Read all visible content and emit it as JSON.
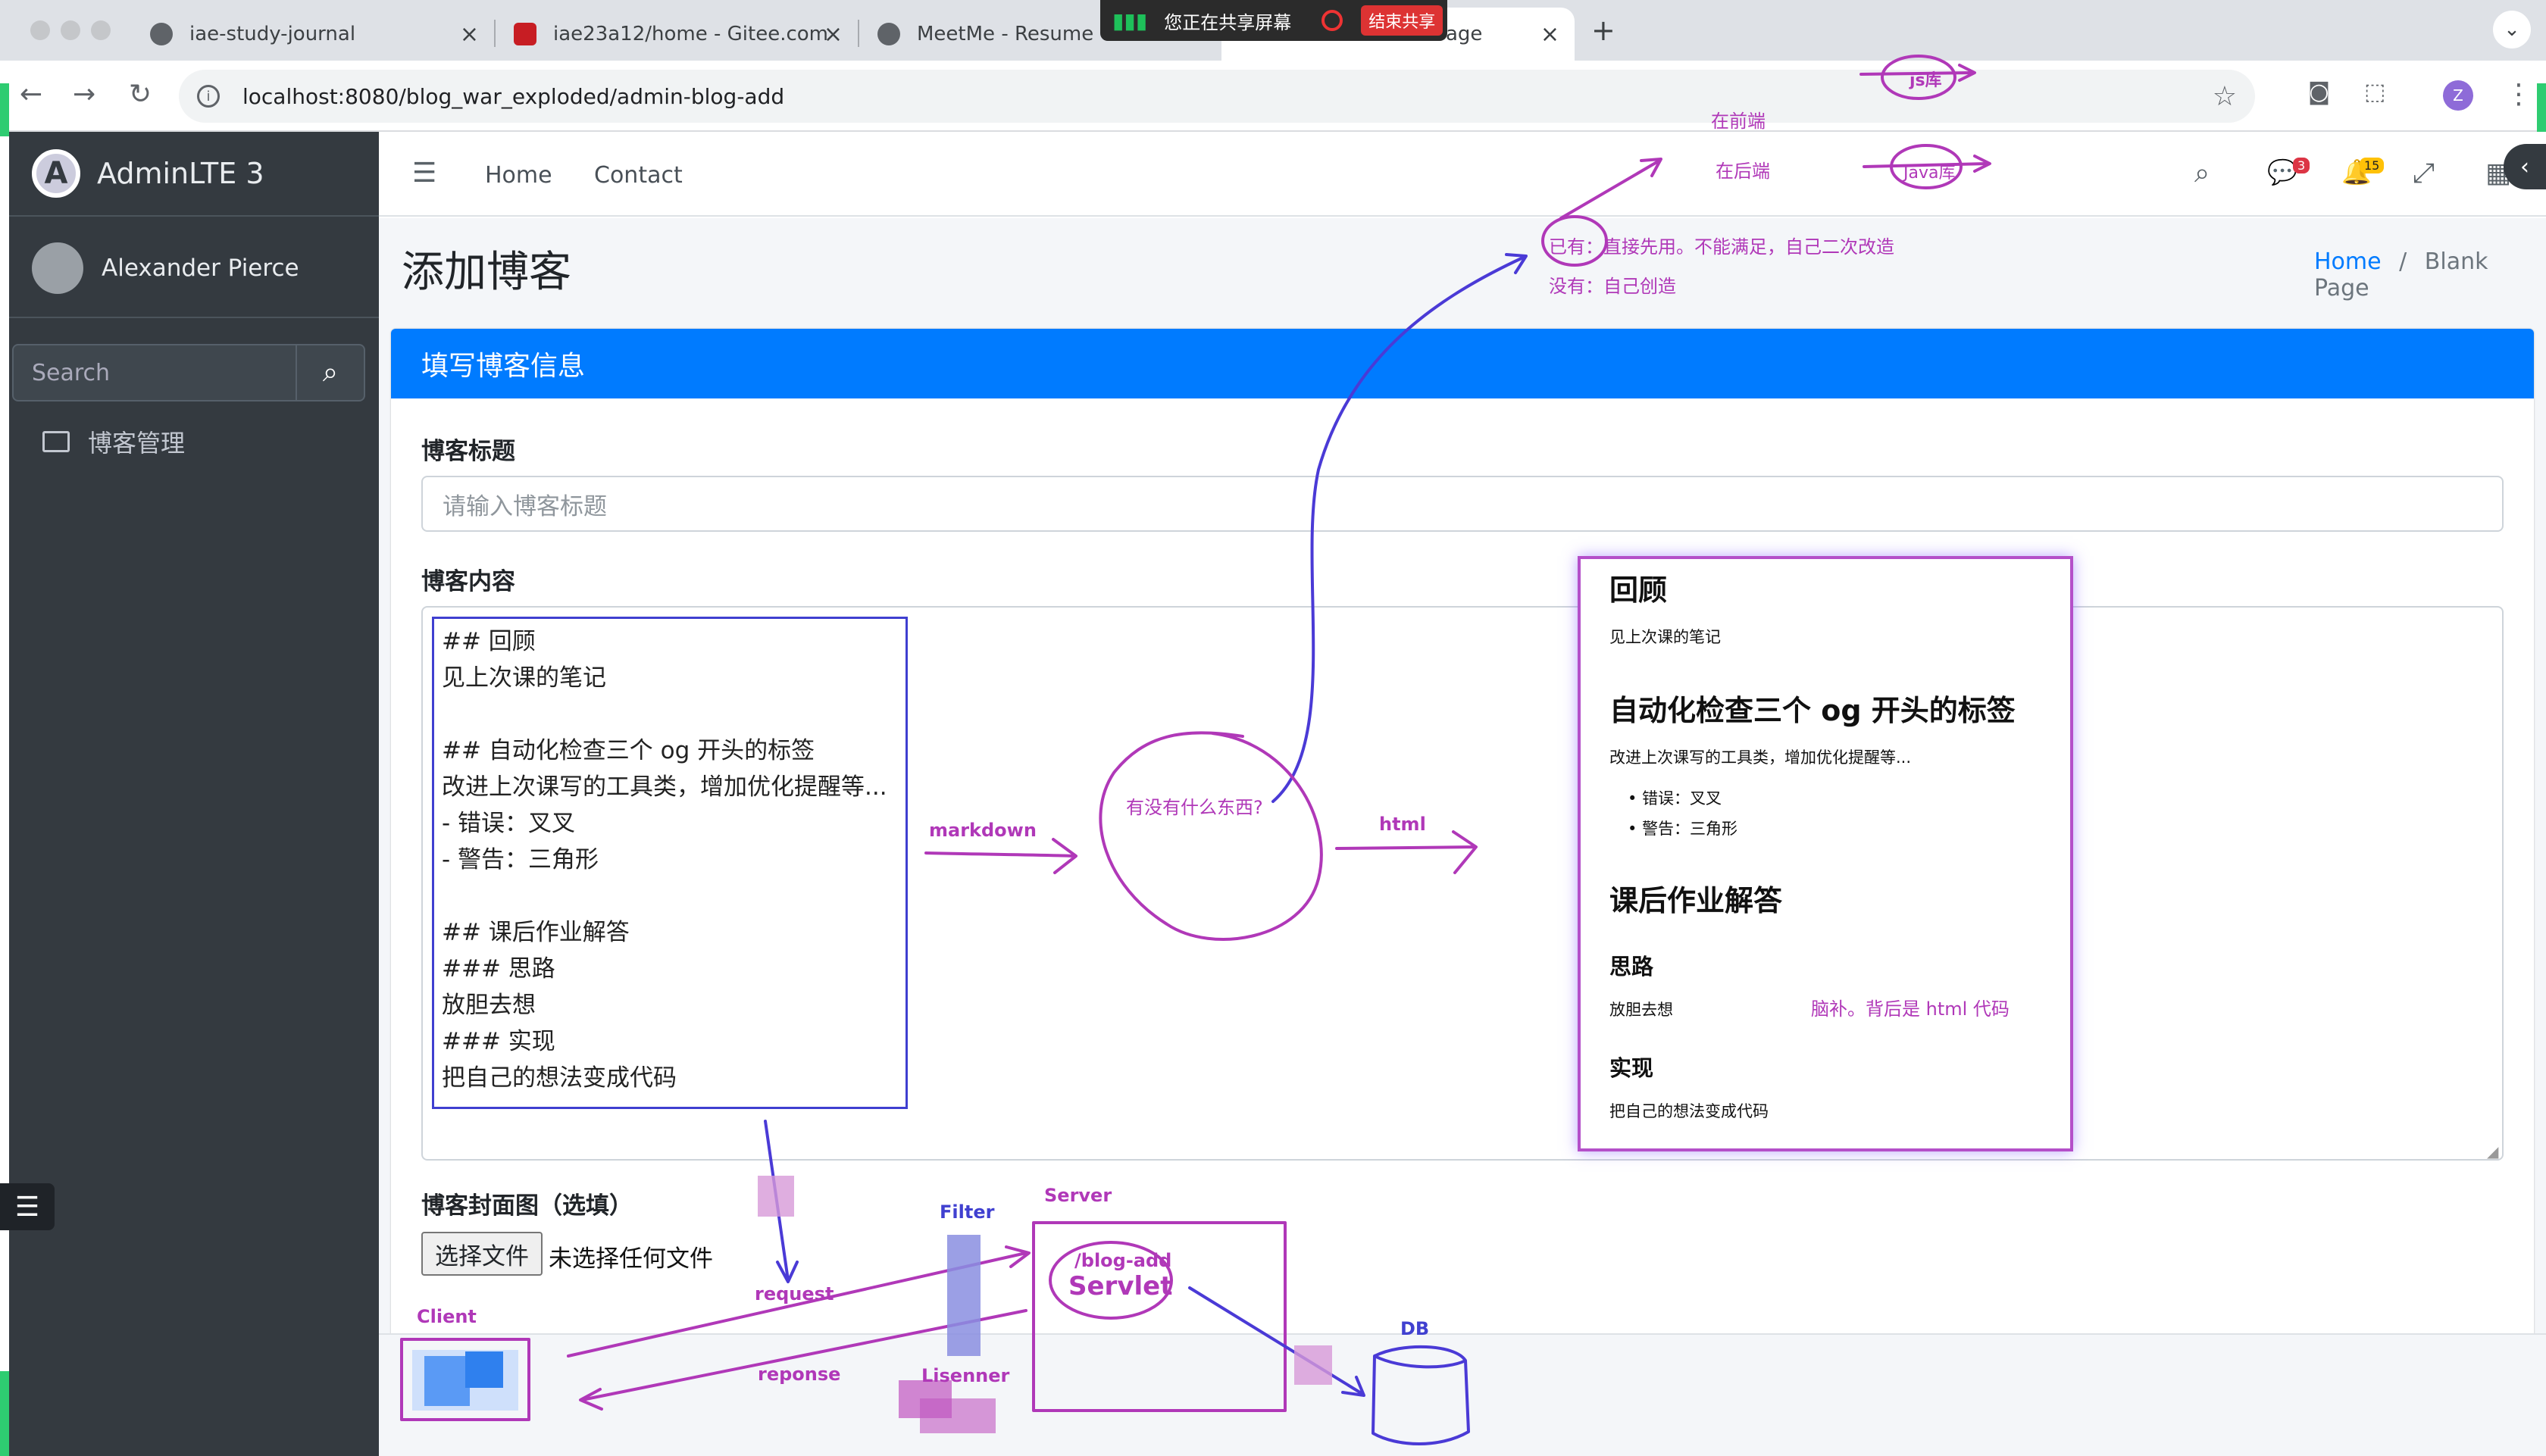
{
  "browser": {
    "tabs": [
      {
        "title": "iae-study-journal"
      },
      {
        "title": "iae23a12/home - Gitee.com"
      },
      {
        "title": "MeetMe - Resume We"
      },
      {
        "title": "age"
      }
    ],
    "new_tab_symbol": "+",
    "share_bar": {
      "text": "您正在共享屏幕",
      "stop_label": "结束共享"
    },
    "url": "localhost:8080/blog_war_exploded/admin-blog-add",
    "profile_initial": "Z"
  },
  "sidebar": {
    "brand": "AdminLTE 3",
    "brand_logo_letter": "A",
    "user_name": "Alexander Pierce",
    "search_placeholder": "Search",
    "menu": [
      {
        "label": "博客管理",
        "icon": "image-icon"
      }
    ]
  },
  "topnav": {
    "links": [
      "Home",
      "Contact"
    ],
    "messages_badge": "3",
    "notifications_badge": "15"
  },
  "page": {
    "title": "添加博客",
    "breadcrumb_home": "Home",
    "breadcrumb_sep": "/",
    "breadcrumb_current": "Blank Page"
  },
  "form": {
    "card_title": "填写博客信息",
    "title_label": "博客标题",
    "title_placeholder": "请输入博客标题",
    "content_label": "博客内容",
    "content_lines": [
      "## 回顾",
      "见上次课的笔记",
      "",
      "## 自动化检查三个 og 开头的标签",
      "改进上次课写的工具类，增加优化提醒等...",
      "- 错误：叉叉",
      "- 警告：三角形",
      "",
      "## 课后作业解答",
      "### 思路",
      "放胆去想",
      "### 实现",
      "把自己的想法变成代码"
    ],
    "cover_label": "博客封面图（选填）",
    "file_button": "选择文件",
    "file_status": "未选择任何文件"
  },
  "preview": {
    "h1_review": "回顾",
    "p_review": "见上次课的笔记",
    "h1_auto": "自动化检查三个 og 开头的标签",
    "p_auto": "改进上次课写的工具类，增加优化提醒等...",
    "bullets": [
      "错误：叉叉",
      "警告：三角形"
    ],
    "h1_homework": "课后作业解答",
    "h3_idea": "思路",
    "p_idea": "放胆去想",
    "h3_impl": "实现",
    "p_impl": "把自己的想法变成代码"
  },
  "annotations": {
    "js_lib": "js库",
    "frontend": "在前端",
    "backend": "在后端",
    "java_lib": "Java库",
    "existing": "已有：直接先用。不能满足，自己二次改造",
    "existing_circle": "已有",
    "missing": "没有：自己创造",
    "markdown": "markdown",
    "question": "有没有什么东西?",
    "html": "html",
    "brain_fill": "脑补。背后是 html 代码",
    "client": "Client",
    "request": "request",
    "reponse": "reponse",
    "filter": "Filter",
    "server": "Server",
    "blog_add": "/blog-add",
    "servlet": "Servlet",
    "listener": "Lisenner",
    "db": "DB"
  },
  "colors": {
    "primary": "#007bff",
    "sidebar": "#343a40",
    "annotation": "#b038b8",
    "ink_blue": "#4040d0"
  }
}
